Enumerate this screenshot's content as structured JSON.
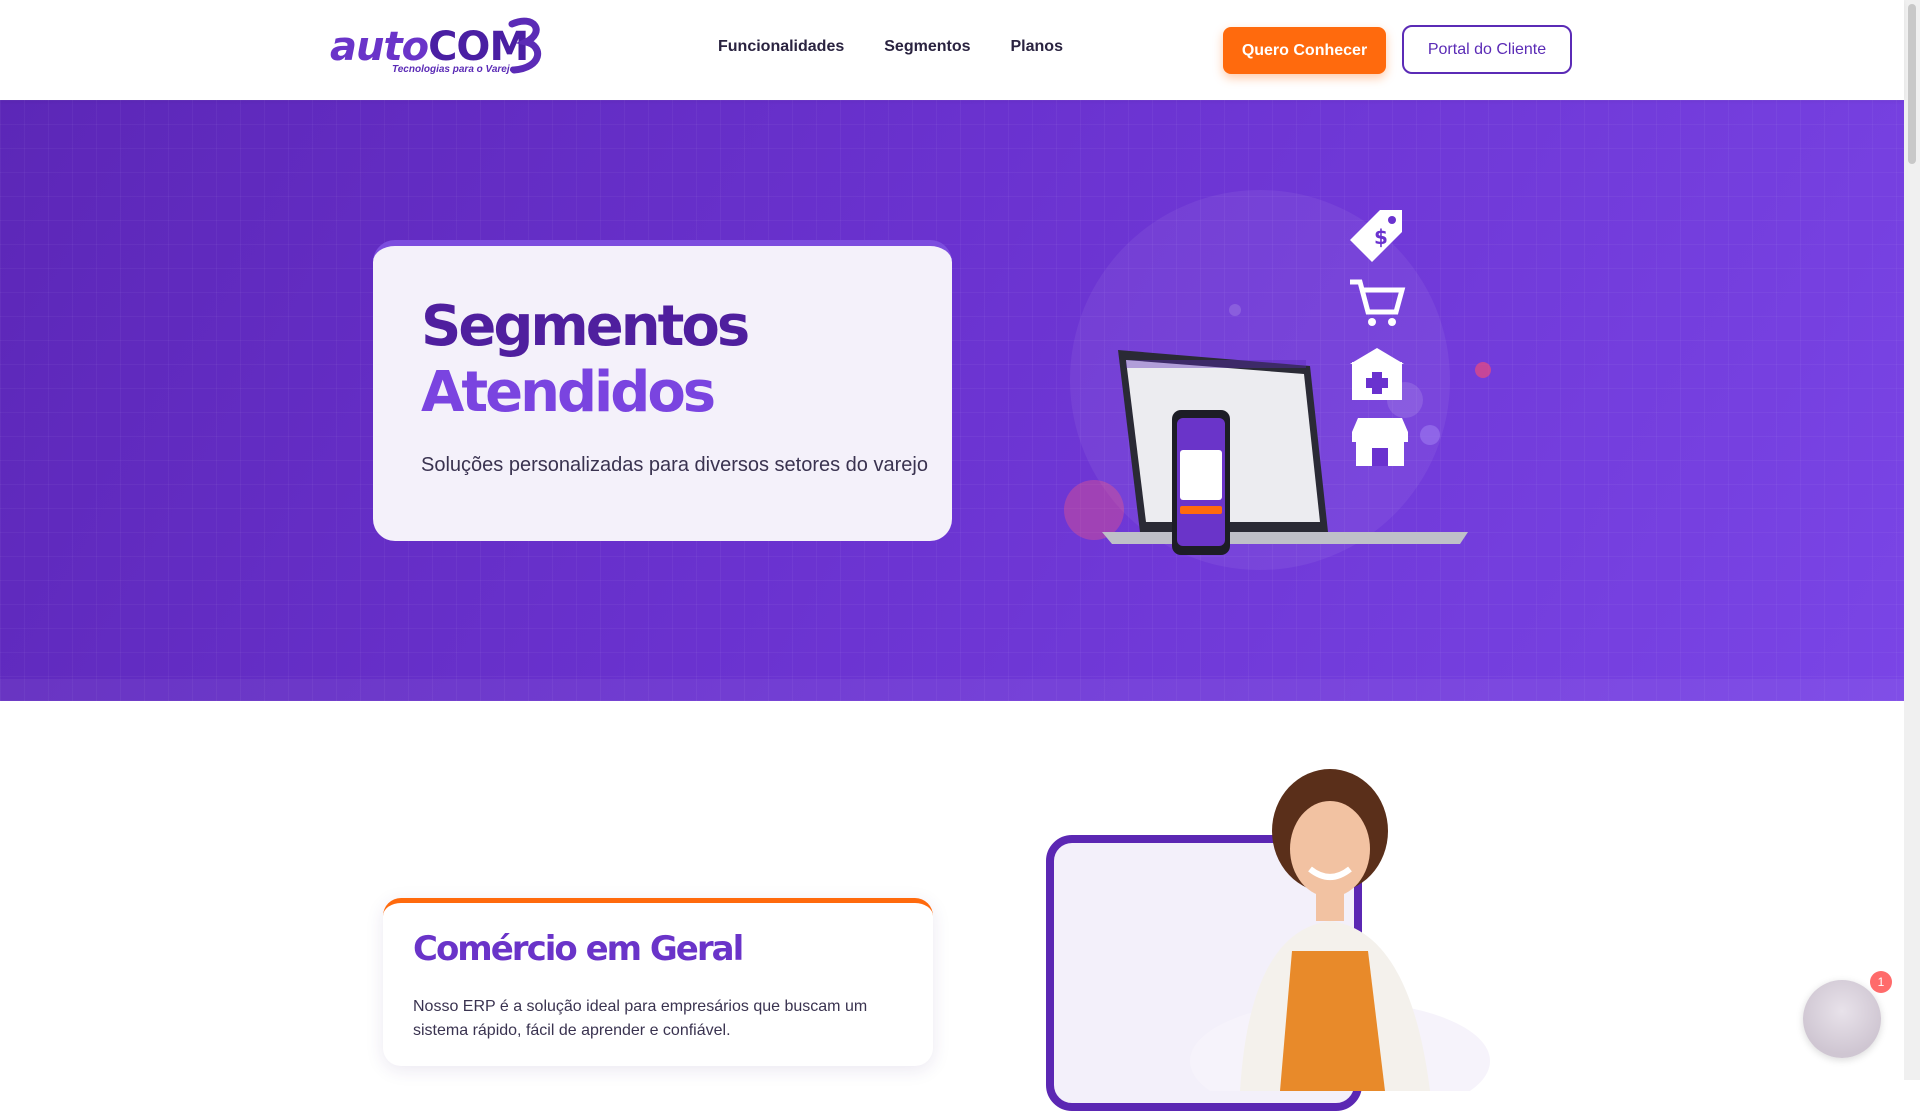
{
  "header": {
    "logo": {
      "brand_part1": "auto",
      "brand_part2": "COM",
      "tagline": "Tecnologias para o Varejo"
    },
    "nav": [
      {
        "label": "Funcionalidades"
      },
      {
        "label": "Segmentos"
      },
      {
        "label": "Planos"
      }
    ],
    "cta_primary": "Quero Conhecer",
    "cta_secondary": "Portal do Cliente"
  },
  "hero": {
    "title_line1": "Segmentos",
    "title_line2": "Atendidos",
    "subtitle": "Soluções personalizadas para diversos setores do varejo",
    "icons": [
      "price-tag-icon",
      "shopping-cart-icon",
      "pharmacy-icon",
      "storefront-icon"
    ]
  },
  "segment": {
    "title": "Comércio em Geral",
    "text": "Nosso ERP é a solução ideal para empresários que buscam um sistema rápido, fácil de aprender e confiável."
  },
  "chat": {
    "badge_count": "1"
  },
  "colors": {
    "primary": "#5b2bb6",
    "accent": "#ff6a0d",
    "hero_bg": "#6a32cf"
  }
}
